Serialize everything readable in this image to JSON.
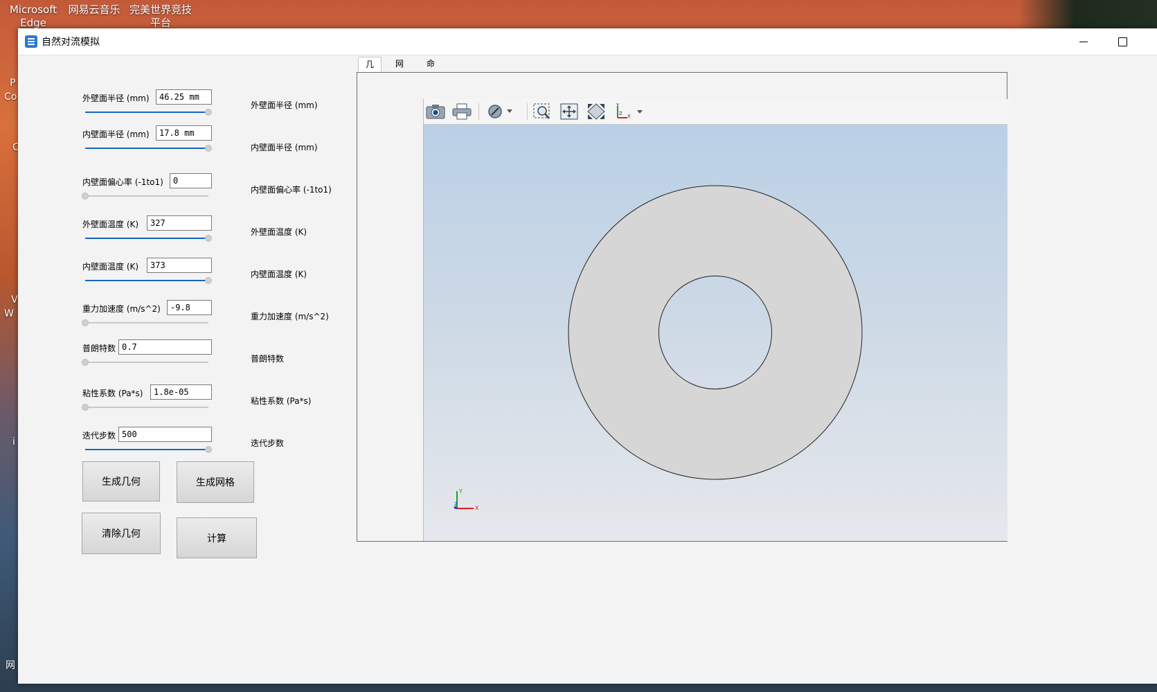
{
  "desktop": {
    "icons": [
      {
        "label": "Microsoft\nEdge"
      },
      {
        "label": "网易云音乐"
      },
      {
        "label": "完美世界竞技\n平台"
      }
    ],
    "left_fragments": [
      "P",
      "Co",
      "C",
      "V",
      "W",
      "i",
      "网"
    ]
  },
  "window": {
    "title": "自然对流模拟",
    "icon": "app-table-icon",
    "controls": {
      "minimize": "minimize-icon",
      "maximize": "maximize-icon"
    }
  },
  "form": {
    "params": [
      {
        "label": "外壁面半径 (mm)",
        "value": "46.25 mm",
        "slider": 1.0,
        "output_label": "外壁面半径 (mm)"
      },
      {
        "label": "内壁面半径 (mm)",
        "value": "17.8 mm",
        "slider": 1.0,
        "output_label": "内壁面半径 (mm)"
      },
      {
        "label": "内壁面偏心率 (-1to1)",
        "value": "0",
        "slider": 0.0,
        "output_label": "内壁面偏心率 (-1to1)"
      },
      {
        "label": "外壁面温度 (K)",
        "value": "327",
        "slider": 1.0,
        "output_label": "外壁面温度 (K)"
      },
      {
        "label": "内壁面温度 (K)",
        "value": "373",
        "slider": 1.0,
        "output_label": "内壁面温度 (K)"
      },
      {
        "label": "重力加速度 (m/s^2)",
        "value": "-9.8",
        "slider": 0.0,
        "output_label": "重力加速度 (m/s^2)"
      },
      {
        "label": "普朗特数",
        "value": "0.7",
        "slider": 0.0,
        "output_label": "普朗特数"
      },
      {
        "label": "粘性系数 (Pa*s)",
        "value": "1.8e-05",
        "slider": 0.0,
        "output_label": "粘性系数 (Pa*s)"
      },
      {
        "label": "迭代步数",
        "value": "500",
        "slider": 1.0,
        "output_label": "迭代步数"
      }
    ],
    "buttons": {
      "generate_geometry": "生成几何",
      "generate_mesh": "生成网格",
      "clear_geometry": "清除几何",
      "compute": "计算"
    }
  },
  "viewer": {
    "tabs": [
      {
        "label": "几何",
        "active": true
      },
      {
        "label": "网格",
        "active": false
      },
      {
        "label": "命令",
        "active": false
      }
    ],
    "toolbar": [
      "camera-icon",
      "print-icon",
      "display-mode-icon",
      "zoom-box-icon",
      "fit-all-icon",
      "fit-view-icon",
      "axes-triad-icon"
    ],
    "geometry": {
      "outer_radius_mm": 46.25,
      "inner_radius_mm": 17.8,
      "eccentricity": 0
    },
    "triad": {
      "x": "X",
      "y": "Y",
      "z": "Z"
    },
    "colors": {
      "ring_fill": "#d6d6d6",
      "bg_top": "#b8cfe6",
      "bg_bottom": "#e6e8ec",
      "x_axis": "#e02020",
      "y_axis": "#20a020",
      "z_axis": "#2030d0"
    }
  }
}
